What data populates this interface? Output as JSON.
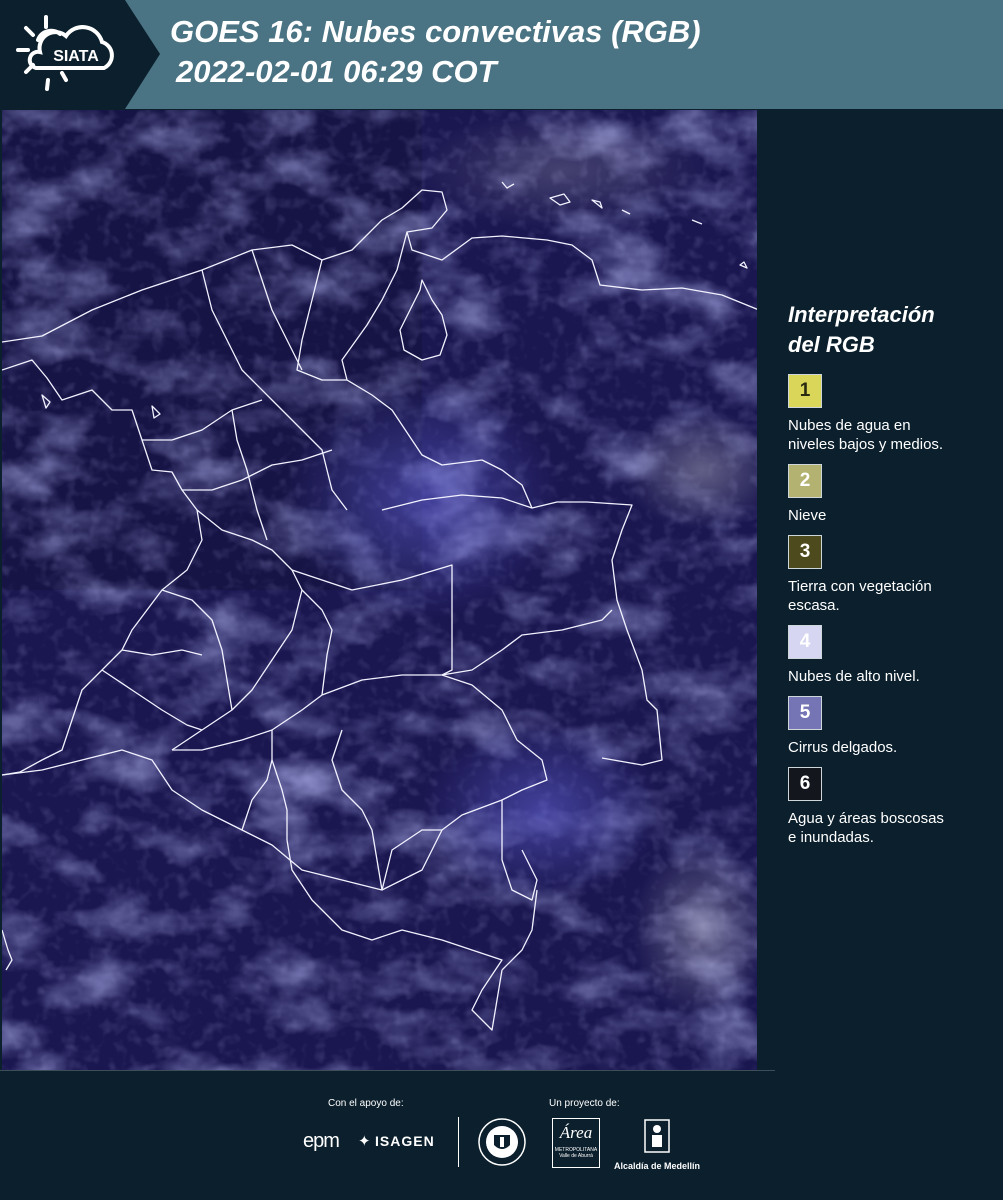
{
  "header": {
    "logo_text": "SIATA",
    "title_line1": "GOES 16: Nubes convectivas (RGB)",
    "title_line2": "2022-02-01 06:29 COT"
  },
  "legend": {
    "title_line1": "Interpretación",
    "title_line2": "del RGB",
    "items": [
      {
        "number": "1",
        "color": "#d9d65a",
        "text_color": "#2a2a10",
        "label_line1": "Nubes de agua en",
        "label_line2": "niveles bajos y medios."
      },
      {
        "number": "2",
        "color": "#b3b271",
        "text_color": "#ffffff",
        "label_line1": "Nieve",
        "label_line2": ""
      },
      {
        "number": "3",
        "color": "#4d4b1d",
        "text_color": "#ffffff",
        "label_line1": "Tierra con vegetación",
        "label_line2": "escasa."
      },
      {
        "number": "4",
        "color": "#d7d6f2",
        "text_color": "#ffffff",
        "label_line1": "Nubes de alto nivel.",
        "label_line2": ""
      },
      {
        "number": "5",
        "color": "#7574b5",
        "text_color": "#ffffff",
        "label_line1": "Cirrus delgados.",
        "label_line2": ""
      },
      {
        "number": "6",
        "color": "#14161d",
        "text_color": "#ffffff",
        "label_line1": "Agua y áreas boscosas",
        "label_line2": "e inundadas."
      }
    ]
  },
  "footer": {
    "support_caption": "Con el apoyo de:",
    "project_caption": "Un proyecto de:",
    "epm_logo": "epm",
    "isagen_logo": "ISAGEN",
    "area_logo": "Área",
    "area_subtitle_line1": "METROPOLITANA",
    "area_subtitle_line2": "Valle de Aburrá",
    "alcaldia_logo": "Alcaldía de Medellín"
  },
  "colors": {
    "header_bg": "#4a7383",
    "page_bg": "#0b1f2c",
    "map_base": "#1e1a5c"
  }
}
